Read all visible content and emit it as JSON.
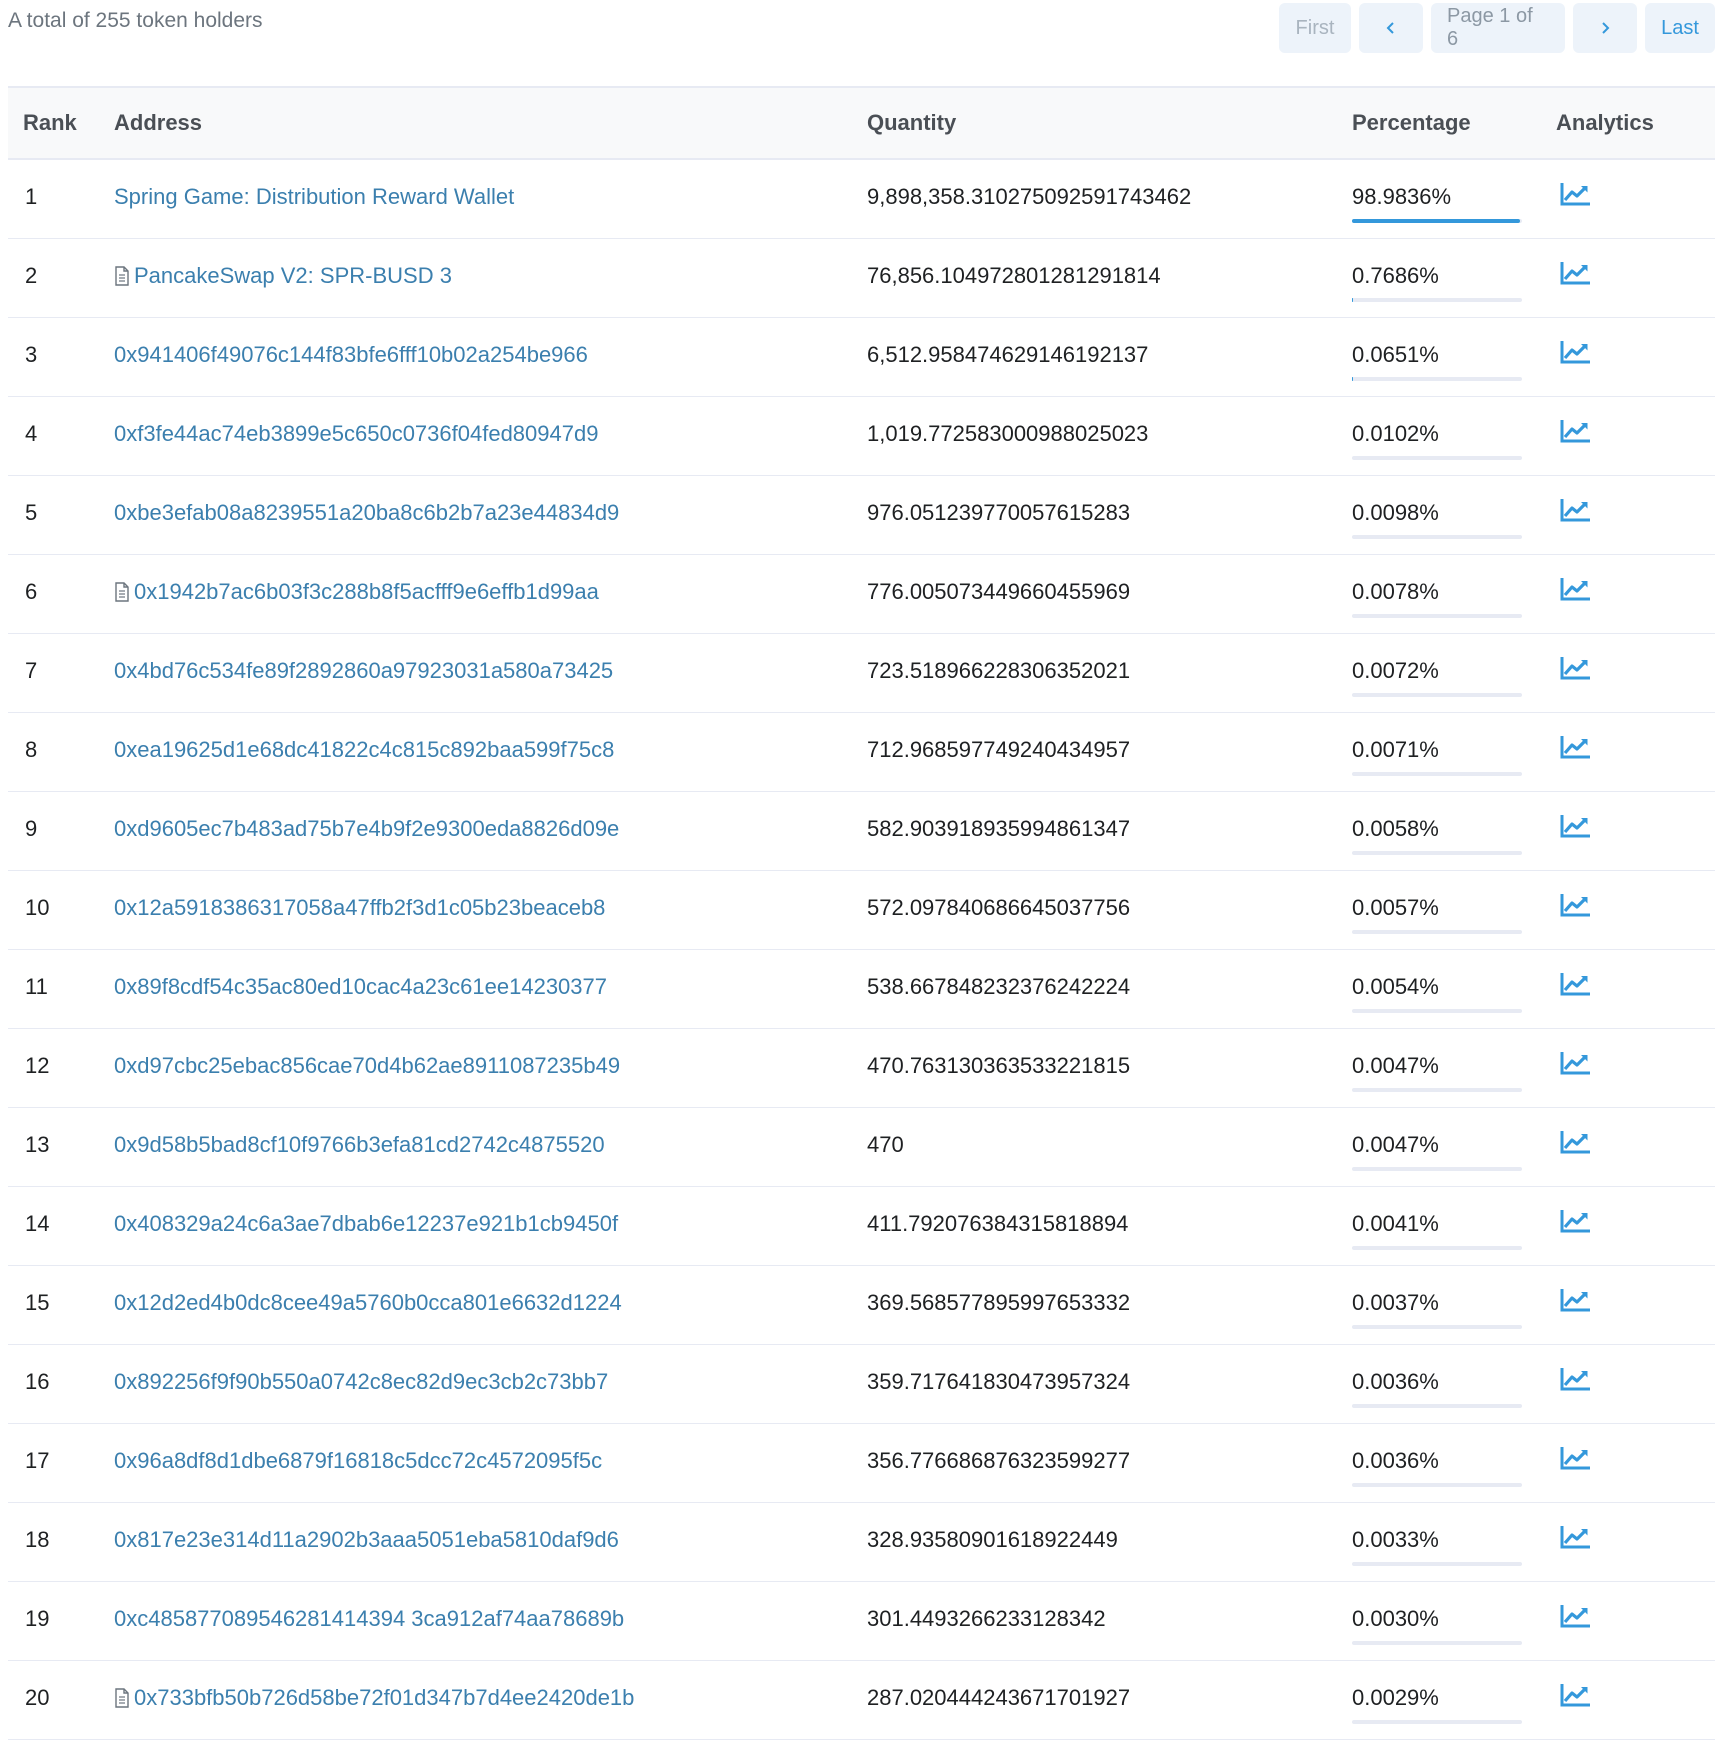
{
  "summary": "A total of 255 token holders",
  "pager": {
    "first": "First",
    "prev_icon": "chevron-left-icon",
    "page": "Page 1 of 6",
    "next_icon": "chevron-right-icon",
    "last": "Last"
  },
  "columns": {
    "rank": "Rank",
    "address": "Address",
    "quantity": "Quantity",
    "percentage": "Percentage",
    "analytics": "Analytics"
  },
  "colors": {
    "link": "#3b7fae",
    "bar": "#3498db",
    "bar_track": "#e7eaf3",
    "icon": "#3498db"
  },
  "rows": [
    {
      "rank": "1",
      "address": "Spring Game: Distribution Reward Wallet",
      "contract": false,
      "quantity": "9,898,358.310275092591743462",
      "percentage": "98.9836%",
      "pct": 98.9836
    },
    {
      "rank": "2",
      "address": "PancakeSwap V2: SPR-BUSD 3",
      "contract": true,
      "quantity": "76,856.104972801281291814",
      "percentage": "0.7686%",
      "pct": 0.7686
    },
    {
      "rank": "3",
      "address": "0x941406f49076c144f83bfe6fff10b02a254be966",
      "contract": false,
      "quantity": "6,512.958474629146192137",
      "percentage": "0.0651%",
      "pct": 0.0651
    },
    {
      "rank": "4",
      "address": "0xf3fe44ac74eb3899e5c650c0736f04fed80947d9",
      "contract": false,
      "quantity": "1,019.772583000988025023",
      "percentage": "0.0102%",
      "pct": 0.0102
    },
    {
      "rank": "5",
      "address": "0xbe3efab08a8239551a20ba8c6b2b7a23e44834d9",
      "contract": false,
      "quantity": "976.051239770057615283",
      "percentage": "0.0098%",
      "pct": 0.0098
    },
    {
      "rank": "6",
      "address": "0x1942b7ac6b03f3c288b8f5acfff9e6effb1d99aa",
      "contract": true,
      "quantity": "776.005073449660455969",
      "percentage": "0.0078%",
      "pct": 0.0078
    },
    {
      "rank": "7",
      "address": "0x4bd76c534fe89f2892860a97923031a580a73425",
      "contract": false,
      "quantity": "723.518966228306352021",
      "percentage": "0.0072%",
      "pct": 0.0072
    },
    {
      "rank": "8",
      "address": "0xea19625d1e68dc41822c4c815c892baa599f75c8",
      "contract": false,
      "quantity": "712.968597749240434957",
      "percentage": "0.0071%",
      "pct": 0.0071
    },
    {
      "rank": "9",
      "address": "0xd9605ec7b483ad75b7e4b9f2e9300eda8826d09e",
      "contract": false,
      "quantity": "582.903918935994861347",
      "percentage": "0.0058%",
      "pct": 0.0058
    },
    {
      "rank": "10",
      "address": "0x12a5918386317058a47ffb2f3d1c05b23beaceb8",
      "contract": false,
      "quantity": "572.097840686645037756",
      "percentage": "0.0057%",
      "pct": 0.0057
    },
    {
      "rank": "11",
      "address": "0x89f8cdf54c35ac80ed10cac4a23c61ee14230377",
      "contract": false,
      "quantity": "538.667848232376242224",
      "percentage": "0.0054%",
      "pct": 0.0054
    },
    {
      "rank": "12",
      "address": "0xd97cbc25ebac856cae70d4b62ae8911087235b49",
      "contract": false,
      "quantity": "470.763130363533221815",
      "percentage": "0.0047%",
      "pct": 0.0047
    },
    {
      "rank": "13",
      "address": "0x9d58b5bad8cf10f9766b3efa81cd2742c4875520",
      "contract": false,
      "quantity": "470",
      "percentage": "0.0047%",
      "pct": 0.0047
    },
    {
      "rank": "14",
      "address": "0x408329a24c6a3ae7dbab6e12237e921b1cb9450f",
      "contract": false,
      "quantity": "411.792076384315818894",
      "percentage": "0.0041%",
      "pct": 0.0041
    },
    {
      "rank": "15",
      "address": "0x12d2ed4b0dc8cee49a5760b0cca801e6632d1224",
      "contract": false,
      "quantity": "369.568577895997653332",
      "percentage": "0.0037%",
      "pct": 0.0037
    },
    {
      "rank": "16",
      "address": "0x892256f9f90b550a0742c8ec82d9ec3cb2c73bb7",
      "contract": false,
      "quantity": "359.717641830473957324",
      "percentage": "0.0036%",
      "pct": 0.0036
    },
    {
      "rank": "17",
      "address": "0x96a8df8d1dbe6879f16818c5dcc72c4572095f5c",
      "contract": false,
      "quantity": "356.776686876323599277",
      "percentage": "0.0036%",
      "pct": 0.0036
    },
    {
      "rank": "18",
      "address": "0x817e23e314d11a2902b3aaa5051eba5810daf9d6",
      "contract": false,
      "quantity": "328.93580901618922449",
      "percentage": "0.0033%",
      "pct": 0.0033
    },
    {
      "rank": "19",
      "address": "0xc485877089546281414394 3ca912af74aa78689b",
      "contract": false,
      "quantity": "301.4493266233128342",
      "percentage": "0.0030%",
      "pct": 0.003
    },
    {
      "rank": "20",
      "address": "0x733bfb50b726d58be72f01d347b7d4ee2420de1b",
      "contract": true,
      "quantity": "287.020444243671701927",
      "percentage": "0.0029%",
      "pct": 0.0029
    }
  ]
}
